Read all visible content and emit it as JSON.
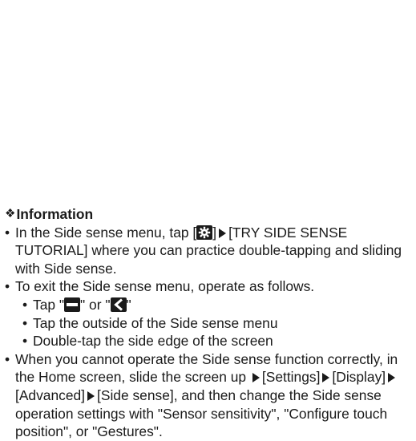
{
  "info": {
    "heading_symbol": "❖",
    "heading": "Information",
    "bullet1": {
      "a": "In the Side sense menu, tap [",
      "b": "]",
      "c": "[TRY SIDE SENSE TUTORIAL] where you can practice double-tapping and sliding with Side sense."
    },
    "bullet2": {
      "text": "To exit the Side sense menu, operate as follows.",
      "sub1": {
        "a": "Tap \"",
        "b": "\" or \"",
        "c": "\""
      },
      "sub2": "Tap the outside of the Side sense menu",
      "sub3": "Double-tap the side edge of the screen"
    },
    "bullet3": {
      "a": "When you cannot operate the Side sense function correctly, in the Home screen, slide the screen up ",
      "b": "[Settings]",
      "c": "[Display]",
      "d": "[Advanced]",
      "e": "[Side sense], and then change the Side sense operation settings with \"Sensor sensitivity\", \"Configure touch position\", or \"Gestures\"."
    }
  },
  "icons": {
    "settings": "gear-icon",
    "minimize": "minus-icon",
    "back": "back-chevron-icon",
    "arrow": "triangle-right-icon"
  }
}
